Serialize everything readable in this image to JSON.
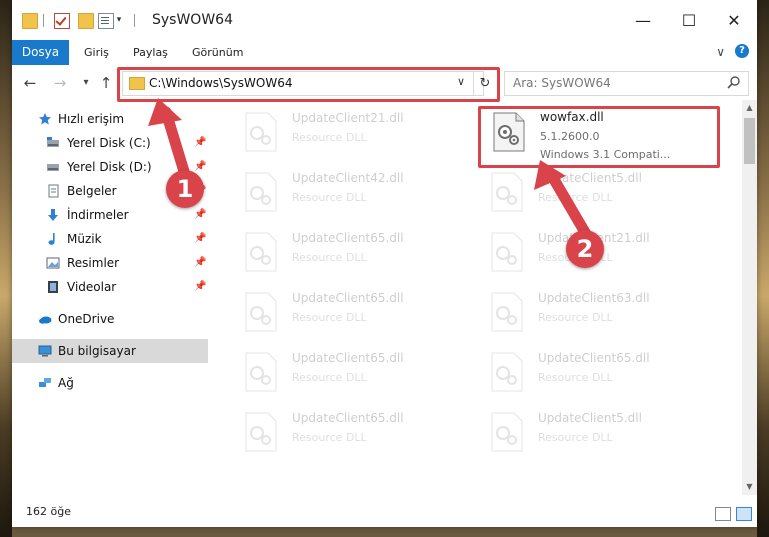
{
  "window": {
    "title": "SysWOW64"
  },
  "ribbon": {
    "tabs": [
      "Dosya",
      "Giriş",
      "Paylaş",
      "Görünüm"
    ]
  },
  "address": {
    "path": "C:\\Windows\\SysWOW64",
    "search_placeholder": "Ara: SysWOW64"
  },
  "sidebar": {
    "items": [
      {
        "label": "Hızlı erişim",
        "icon": "star-icon",
        "pinned": false
      },
      {
        "label": "Yerel Disk (C:)",
        "icon": "drive-icon",
        "pinned": true
      },
      {
        "label": "Yerel Disk (D:)",
        "icon": "drive-icon",
        "pinned": true
      },
      {
        "label": "Belgeler",
        "icon": "document-icon",
        "pinned": true
      },
      {
        "label": "İndirmeler",
        "icon": "download-icon",
        "pinned": true
      },
      {
        "label": "Müzik",
        "icon": "music-icon",
        "pinned": true
      },
      {
        "label": "Resimler",
        "icon": "pictures-icon",
        "pinned": true
      },
      {
        "label": "Videolar",
        "icon": "video-icon",
        "pinned": true
      },
      {
        "label": "OneDrive",
        "icon": "cloud-icon",
        "pinned": false
      },
      {
        "label": "Bu bilgisayar",
        "icon": "computer-icon",
        "pinned": false
      },
      {
        "label": "Ağ",
        "icon": "network-icon",
        "pinned": false
      }
    ]
  },
  "files": [
    {
      "name": "UpdateClient21.dll",
      "type": "Resource DLL",
      "faded": true
    },
    {
      "name": "wowfax.dll",
      "version": "5.1.2600.0",
      "description": "Windows 3.1 Compati...",
      "faded": false
    },
    {
      "name": "UpdateClient42.dll",
      "type": "Resource DLL",
      "faded": true
    },
    {
      "name": "UpdateClient5.dll",
      "type": "Resource DLL",
      "faded": true
    },
    {
      "name": "UpdateClient65.dll",
      "type": "Resource DLL",
      "faded": true
    },
    {
      "name": "UpdateClient21.dll",
      "type": "Resource DLL",
      "faded": true
    },
    {
      "name": "UpdateClient65.dll",
      "type": "Resource DLL",
      "faded": true
    },
    {
      "name": "UpdateClient63.dll",
      "type": "Resource DLL",
      "faded": true
    },
    {
      "name": "UpdateClient65.dll",
      "type": "Resource DLL",
      "faded": true
    },
    {
      "name": "UpdateClient65.dll",
      "type": "Resource DLL",
      "faded": true
    },
    {
      "name": "UpdateClient65.dll",
      "type": "Resource DLL",
      "faded": true
    },
    {
      "name": "UpdateClient5.dll",
      "type": "Resource DLL",
      "faded": true
    }
  ],
  "status": {
    "count": "162 öğe"
  },
  "annotations": {
    "marker1": "1",
    "marker2": "2",
    "color": "#d9434a"
  }
}
